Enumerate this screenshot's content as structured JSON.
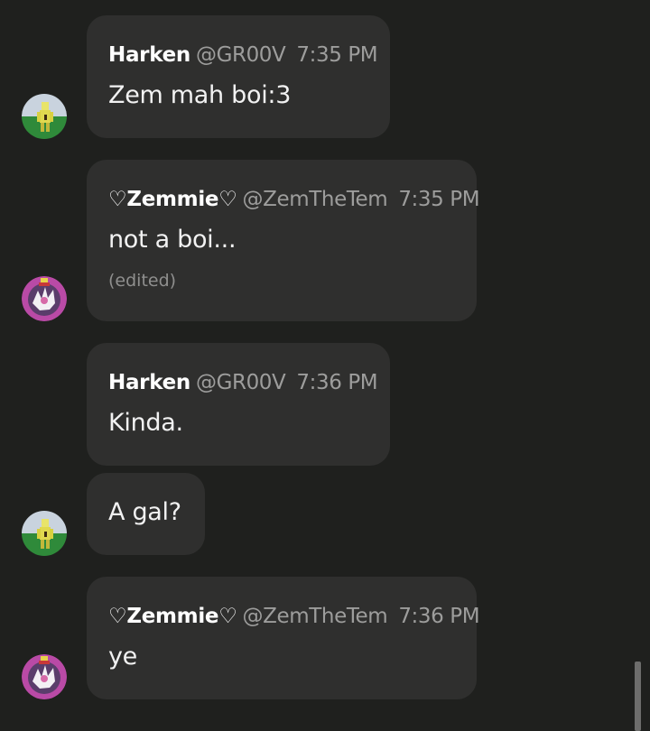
{
  "messages": [
    {
      "name": "Harken",
      "handle": "@GR00V",
      "time": "7:35 PM",
      "text": "Zem mah boi:3"
    },
    {
      "name": "♡Zemmie♡",
      "handle": "@ZemTheTem",
      "time": "7:35 PM",
      "text": "not a boi...",
      "edited": "(edited)"
    },
    {
      "name": "Harken",
      "handle": "@GR00V",
      "time": "7:36 PM",
      "text": "Kinda."
    },
    {
      "text": "A gal?"
    },
    {
      "name": "♡Zemmie♡",
      "handle": "@ZemTheTem",
      "time": "7:36 PM",
      "text": "ye"
    }
  ],
  "avatars": {
    "harken": "harken-avatar",
    "zemmie": "zemmie-avatar"
  },
  "colors": {
    "background": "#1f201e",
    "bubble": "#2f2f2e",
    "meta_text": "#9d9d9c"
  }
}
